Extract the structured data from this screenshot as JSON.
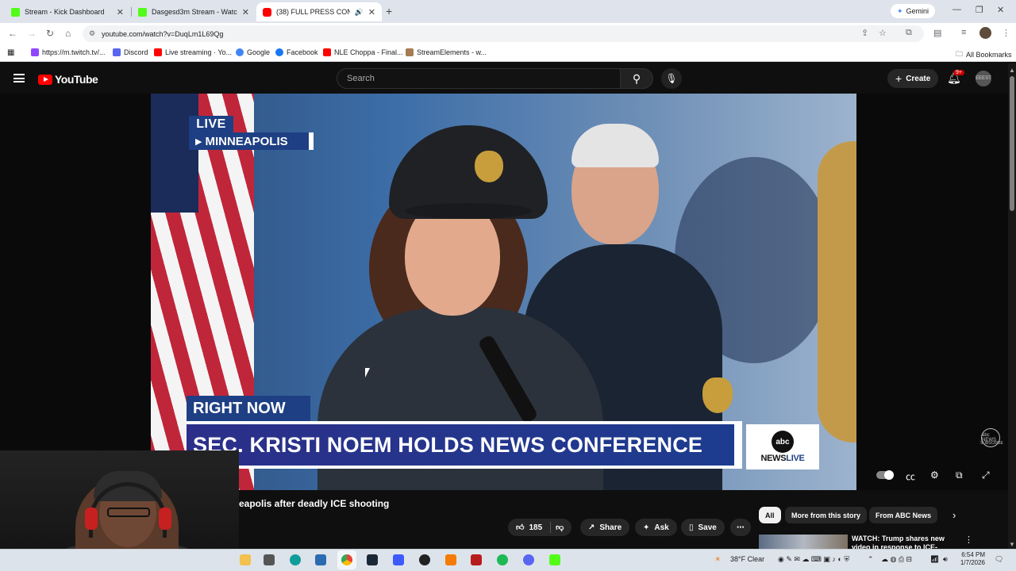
{
  "browser": {
    "tabs": [
      {
        "title": "Stream - Kick Dashboard",
        "active": false
      },
      {
        "title": "Dasgesd3m Stream - Watch Live",
        "active": false
      },
      {
        "title": "(38) FULL PRESS CONFERENCE",
        "active": true
      }
    ],
    "gemini_label": "Gemini",
    "url": "youtube.com/watch?v=DuqLm1L69Qg",
    "bookmarks": [
      {
        "label": "https://m.twitch.tv/...",
        "color": "#9146ff"
      },
      {
        "label": "Discord",
        "color": "#5865f2"
      },
      {
        "label": "Live streaming · Yo...",
        "color": "#ff0000"
      },
      {
        "label": "Google",
        "color": "#4285f4"
      },
      {
        "label": "Facebook",
        "color": "#1877f2"
      },
      {
        "label": "NLE Choppa - Final...",
        "color": "#ff0000"
      },
      {
        "label": "StreamElements - w...",
        "color": "#a67c52"
      }
    ],
    "all_bookmarks_label": "All Bookmarks"
  },
  "youtube": {
    "logo_text": "YouTube",
    "search_placeholder": "Search",
    "create_label": "Create",
    "notification_count": "9+",
    "avatar_text": "EEEST"
  },
  "video": {
    "live_tag": "LIVE",
    "location_tag": "MINNEAPOLIS",
    "right_now_tag": "RIGHT NOW",
    "headline": "SEC. KRISTI NOEM HOLDS NEWS CONFERENCE",
    "network_logo": "abc",
    "network_news": "NEWS",
    "network_live": "LIVE",
    "watermark": "abc NEWS",
    "watermark_sub": "SUBSCRIBE"
  },
  "below": {
    "title": "eapolis after deadly ICE shooting",
    "like_count": "185",
    "share_label": "Share",
    "ask_label": "Ask",
    "save_label": "Save",
    "chips": [
      "All",
      "More from this story",
      "From ABC News"
    ],
    "rec_title": "WATCH: Trump shares new video in response to ICE-"
  },
  "taskbar": {
    "weather": "38°F  Clear",
    "time": "6:54 PM",
    "date": "1/7/2026"
  }
}
